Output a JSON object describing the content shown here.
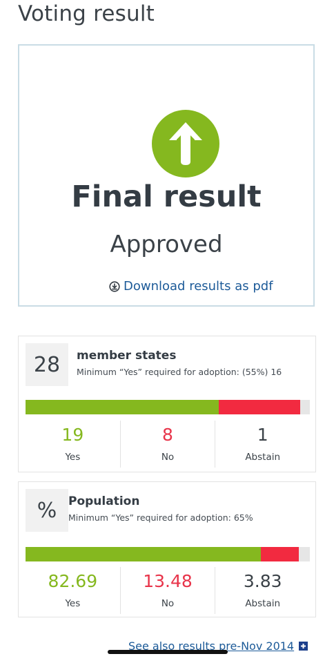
{
  "page": {
    "title": "Voting result"
  },
  "final": {
    "title": "Final result",
    "status": "Approved",
    "download_label": "Download results as pdf",
    "icon": "up-arrow-circle-icon",
    "accent": "#85b81f"
  },
  "member_states": {
    "badge": "28",
    "title": "member states",
    "subtitle": "Minimum “Yes” required for adoption: (55%) 16",
    "yes": "19",
    "no": "8",
    "abstain": "1",
    "yes_label": "Yes",
    "no_label": "No",
    "abstain_label": "Abstain",
    "yes_fraction": 0.68,
    "no_fraction": 0.285
  },
  "population": {
    "badge": "%",
    "title": "Population",
    "subtitle": "Minimum “Yes” required for adoption: 65%",
    "yes": "82.69",
    "no": "13.48",
    "abstain": "3.83",
    "yes_label": "Yes",
    "no_label": "No",
    "abstain_label": "Abstain",
    "yes_fraction": 0.8269,
    "no_fraction": 0.1348
  },
  "footer": {
    "see_also_label": "See also results pre-Nov 2014",
    "see_also_icon": "plus-square-icon"
  },
  "colors": {
    "yes": "#85b81f",
    "no": "#f22a40",
    "link": "#1c5a98"
  }
}
